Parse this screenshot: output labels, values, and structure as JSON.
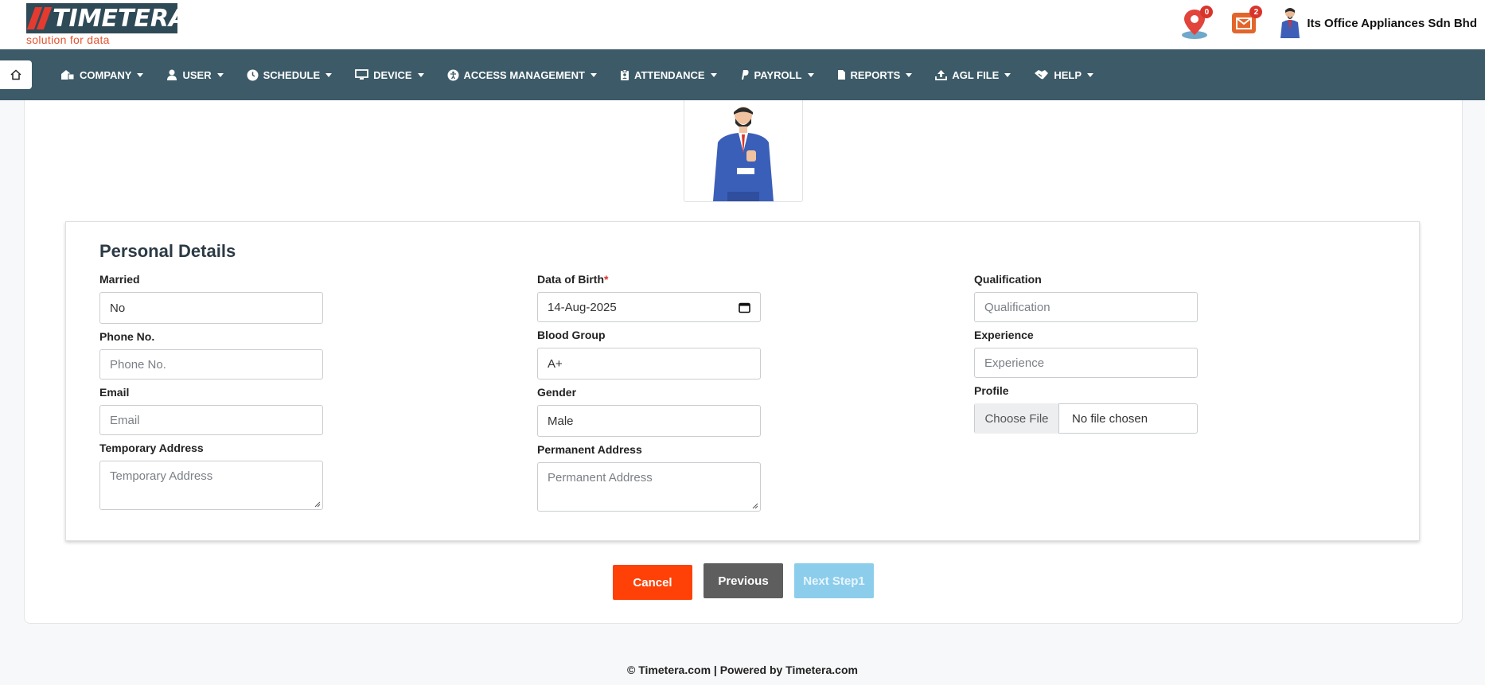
{
  "brand": {
    "name": "TIMETERA",
    "tagline": "solution for data",
    "logo_color": "#2f4a57",
    "accent": "#e53a2f"
  },
  "header": {
    "location_badge": "0",
    "mail_badge": "2",
    "company_name": "Its Office Appliances Sdn Bhd"
  },
  "nav": {
    "home_icon": "home-icon",
    "items": [
      {
        "label": "COMPANY",
        "icon": "company-icon"
      },
      {
        "label": "USER",
        "icon": "user-icon"
      },
      {
        "label": "SCHEDULE",
        "icon": "clock-icon"
      },
      {
        "label": "DEVICE",
        "icon": "monitor-icon"
      },
      {
        "label": "ACCESS MANAGEMENT",
        "icon": "accessibility-icon"
      },
      {
        "label": "ATTENDANCE",
        "icon": "badge-icon"
      },
      {
        "label": "PAYROLL",
        "icon": "paypal-icon"
      },
      {
        "label": "REPORTS",
        "icon": "file-icon"
      },
      {
        "label": "AGL FILE",
        "icon": "upload-icon"
      },
      {
        "label": "HELP",
        "icon": "handshake-icon"
      }
    ],
    "background": "#3c5a67"
  },
  "personal": {
    "title": "Personal Details",
    "married": {
      "label": "Married",
      "value": "No"
    },
    "phone": {
      "label": "Phone No.",
      "placeholder": "Phone No."
    },
    "email": {
      "label": "Email",
      "placeholder": "Email"
    },
    "temp_address": {
      "label": "Temporary Address",
      "placeholder": "Temporary Address"
    },
    "dob": {
      "label": "Data of Birth",
      "required": "*",
      "value": "14-Aug-2025"
    },
    "blood_group": {
      "label": "Blood Group",
      "value": "A+"
    },
    "gender": {
      "label": "Gender",
      "value": "Male"
    },
    "perm_address": {
      "label": "Permanent Address",
      "placeholder": "Permanent Address"
    },
    "qualification": {
      "label": "Qualification",
      "placeholder": "Qualification"
    },
    "experience": {
      "label": "Experience",
      "placeholder": "Experience"
    },
    "profile": {
      "label": "Profile",
      "button": "Choose File",
      "status": "No file chosen"
    }
  },
  "actions": {
    "cancel": "Cancel",
    "previous": "Previous",
    "next": "Next Step1",
    "cancel_color": "#ff4107",
    "previous_color": "#5e5e5e",
    "next_color": "#8dcdec"
  },
  "footer": {
    "text": "© Timetera.com  |  Powered by Timetera.com"
  }
}
